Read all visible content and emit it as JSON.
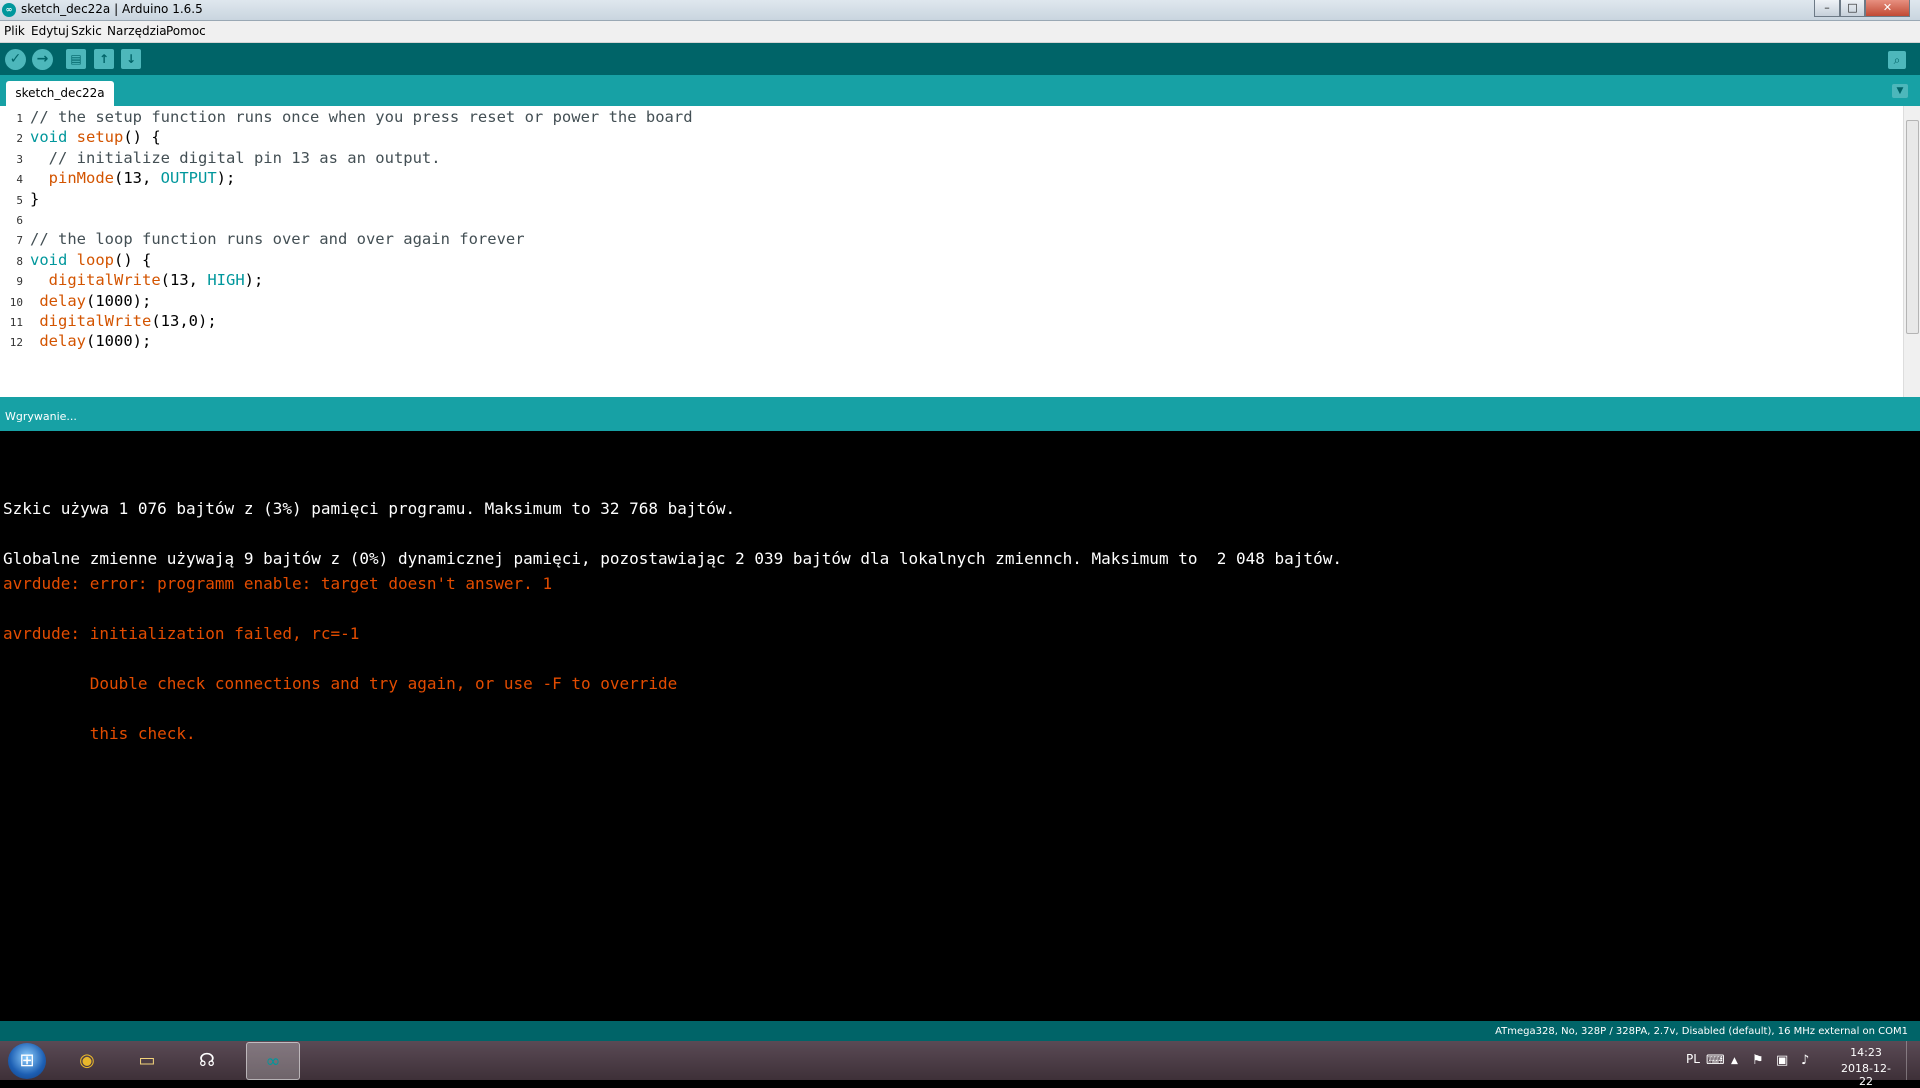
{
  "window": {
    "logo": "∞",
    "title": "sketch_dec22a | Arduino 1.6.5",
    "buttons": {
      "minimize": "–",
      "maximize": "□",
      "close": "✕"
    }
  },
  "menu": [
    "Plik",
    "Edytuj",
    "Szkic",
    "Narzędzia",
    "Pomoc"
  ],
  "toolbar": {
    "verify_icon": "✓",
    "upload_icon": "→",
    "new_icon": "▤",
    "open_icon": "↑",
    "save_icon": "↓",
    "serial_monitor_icon": "⌕"
  },
  "tabs": {
    "active": "sketch_dec22a",
    "menu_icon": "▼"
  },
  "editor": {
    "line_numbers": [
      "1",
      "2",
      "3",
      "4",
      "5",
      "6",
      "7",
      "8",
      "9",
      "10",
      "11",
      "12"
    ],
    "lines": [
      [
        {
          "t": "// the setup function runs once when you press reset or power the board",
          "c": "comment"
        }
      ],
      [
        {
          "t": "void",
          "c": "type"
        },
        {
          "t": " "
        },
        {
          "t": "setup",
          "c": "fn"
        },
        {
          "t": "() {"
        }
      ],
      [
        {
          "t": "  // initialize digital pin 13 as an output.",
          "c": "comment"
        }
      ],
      [
        {
          "t": "  "
        },
        {
          "t": "pinMode",
          "c": "fn"
        },
        {
          "t": "(13, "
        },
        {
          "t": "OUTPUT",
          "c": "const"
        },
        {
          "t": ");"
        }
      ],
      [
        {
          "t": "}"
        }
      ],
      [],
      [
        {
          "t": "// the loop function runs over and over again forever",
          "c": "comment"
        }
      ],
      [
        {
          "t": "void",
          "c": "type"
        },
        {
          "t": " "
        },
        {
          "t": "loop",
          "c": "fn"
        },
        {
          "t": "() {"
        }
      ],
      [
        {
          "t": "  "
        },
        {
          "t": "digitalWrite",
          "c": "fn"
        },
        {
          "t": "(13, "
        },
        {
          "t": "HIGH",
          "c": "const"
        },
        {
          "t": ");"
        }
      ],
      [
        {
          "t": " "
        },
        {
          "t": "delay",
          "c": "fn"
        },
        {
          "t": "(1000);"
        }
      ],
      [
        {
          "t": " "
        },
        {
          "t": "digitalWrite",
          "c": "fn"
        },
        {
          "t": "(13,0);"
        }
      ],
      [
        {
          "t": " "
        },
        {
          "t": "delay",
          "c": "fn"
        },
        {
          "t": "(1000);"
        }
      ]
    ]
  },
  "status": {
    "text": "Wgrywanie..."
  },
  "console": [
    {
      "t": "Szkic używa 1 076 bajtów z (3%) pamięci programu. Maksimum to 32 768 bajtów.",
      "c": "white",
      "row": 2
    },
    {
      "t": "Globalne zmienne używają 9 bajtów z (0%) dynamicznej pamięci, pozostawiając 2 039 bajtów dla lokalnych zmiennch. Maksimum to  2 048 bajtów.",
      "c": "white",
      "row": 4
    },
    {
      "t": "avrdude: error: programm enable: target doesn't answer. 1",
      "c": "red",
      "row": 5
    },
    {
      "t": "avrdude: initialization failed, rc=-1",
      "c": "red",
      "row": 7
    },
    {
      "t": "         Double check connections and try again, or use -F to override",
      "c": "red",
      "row": 9
    },
    {
      "t": "         this check.",
      "c": "red",
      "row": 11
    }
  ],
  "board_info": "ATmega328, No, 328P / 328PA, 2.7v, Disabled (default), 16 MHz external on COM1",
  "taskbar": {
    "start_icon": "⊞",
    "apps": [
      {
        "name": "chrome",
        "icon": "◉",
        "color": "#e9b72b",
        "active": false
      },
      {
        "name": "explorer",
        "icon": "▭",
        "color": "#f3d37a",
        "active": false
      },
      {
        "name": "support",
        "icon": "☊",
        "color": "#ffffff",
        "active": false
      },
      {
        "name": "arduino",
        "icon": "∞",
        "color": "#00979c",
        "active": true
      }
    ],
    "tray": {
      "language": "PL",
      "icons": [
        "⌨",
        "▲",
        "⚑",
        "▣",
        "♪"
      ],
      "time": "14:23",
      "date": "2018-12-22"
    }
  }
}
